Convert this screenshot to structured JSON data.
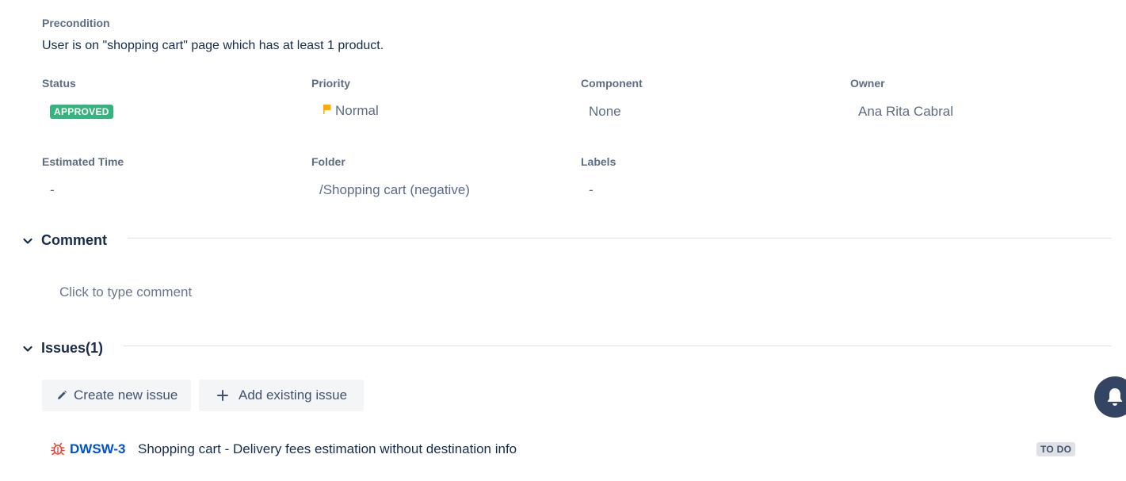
{
  "precondition": {
    "label": "Precondition",
    "text": "User is on \"shopping cart\" page which has at least 1 product."
  },
  "fields": {
    "status": {
      "label": "Status",
      "value": "APPROVED",
      "color": "#36b37e"
    },
    "priority": {
      "label": "Priority",
      "value": "Normal",
      "icon": "flag-icon",
      "color": "#ffab00"
    },
    "component": {
      "label": "Component",
      "value": "None"
    },
    "owner": {
      "label": "Owner",
      "value": "Ana Rita Cabral"
    },
    "estimated_time": {
      "label": "Estimated Time",
      "value": "-"
    },
    "folder": {
      "label": "Folder",
      "value": "/Shopping cart (negative)"
    },
    "labels": {
      "label": "Labels",
      "value": "-"
    }
  },
  "comment": {
    "title": "Comment",
    "placeholder": "Click to type comment"
  },
  "issues": {
    "title": "Issues(1)",
    "create_label": "Create new issue",
    "add_label": "Add existing issue",
    "items": [
      {
        "icon": "bug-icon",
        "key": "DWSW-3",
        "summary": "Shopping cart - Delivery fees estimation without destination info",
        "status": "TO DO"
      }
    ]
  },
  "colors": {
    "link": "#0052cc",
    "bug": "#e5493a",
    "fab": "#344563"
  }
}
